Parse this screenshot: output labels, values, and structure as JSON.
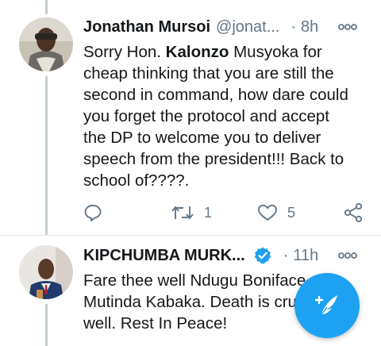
{
  "tweets": [
    {
      "author_name": "Jonathan Mursoi",
      "handle": "@jonat...",
      "separator": "·",
      "time": "8h",
      "text_lines": [
        {
          "pre": "Sorry Hon. ",
          "bold": "Kalonzo",
          "post": " Musyoka for"
        },
        "cheap thinking that you are still the",
        "second in command, how dare could",
        "you forget the protocol and accept",
        "the DP to welcome you to deliver",
        "speech from the president!!! Back to",
        "school of????."
      ],
      "retweet_count": "1",
      "like_count": "5",
      "icons": {
        "reply": "reply-icon",
        "retweet": "retweet-icon",
        "like": "heart-icon",
        "share": "share-icon",
        "more": "more-icon"
      }
    },
    {
      "author_name": "KIPCHUMBA MURK...",
      "separator": "·",
      "time": "11h",
      "verified": true,
      "text_lines": [
        "Fare thee well Ndugu Boniface",
        "Mutinda Kabaka. Death is cru",
        "well. Rest In Peace!"
      ]
    }
  ],
  "colors": {
    "accent": "#1da1f2",
    "secondary_text": "#657786",
    "thread_line": "#c4cfd6"
  },
  "fab": {
    "icon": "compose-tweet-icon"
  }
}
